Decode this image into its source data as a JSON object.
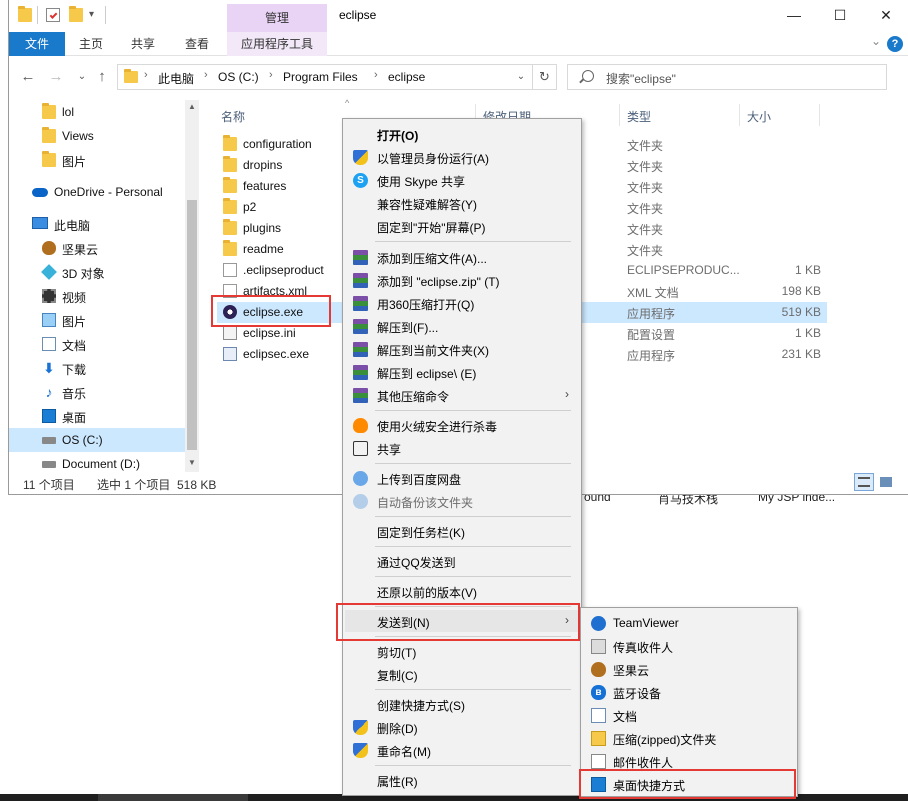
{
  "window": {
    "title": "eclipse",
    "manage_tab": "管理",
    "controls": {
      "minimize": "—",
      "maximize": "☐",
      "close": "✕"
    }
  },
  "ribbon": {
    "file": "文件",
    "tabs": [
      "主页",
      "共享",
      "查看"
    ],
    "app_tools": "应用程序工具",
    "help": "?"
  },
  "address": {
    "crumbs": [
      "此电脑",
      "OS (C:)",
      "Program Files",
      "eclipse"
    ],
    "search_placeholder": "搜索\"eclipse\""
  },
  "nav": {
    "items": [
      {
        "label": "lol",
        "icon": "folder-icon"
      },
      {
        "label": "Views",
        "icon": "folder-icon"
      },
      {
        "label": "图片",
        "icon": "folder-icon"
      },
      {
        "label": "OneDrive - Personal",
        "icon": "onedrive-icon"
      },
      {
        "label": "此电脑",
        "icon": "computer-icon"
      },
      {
        "label": "坚果云",
        "icon": "nutstore-icon"
      },
      {
        "label": "3D 对象",
        "icon": "3d-objects-icon"
      },
      {
        "label": "视频",
        "icon": "video-icon"
      },
      {
        "label": "图片",
        "icon": "pictures-icon"
      },
      {
        "label": "文档",
        "icon": "documents-icon"
      },
      {
        "label": "下载",
        "icon": "download-icon"
      },
      {
        "label": "音乐",
        "icon": "music-icon"
      },
      {
        "label": "桌面",
        "icon": "desktop-icon"
      },
      {
        "label": "OS (C:)",
        "icon": "drive-icon"
      },
      {
        "label": "Document (D:)",
        "icon": "drive-icon"
      }
    ]
  },
  "columns": {
    "name": "名称",
    "modified": "修改日期",
    "type": "类型",
    "size": "大小"
  },
  "files": [
    {
      "name": "configuration",
      "type": "文件夹",
      "size": ""
    },
    {
      "name": "dropins",
      "type": "文件夹",
      "size": ""
    },
    {
      "name": "features",
      "type": "文件夹",
      "size": ""
    },
    {
      "name": "p2",
      "type": "文件夹",
      "size": ""
    },
    {
      "name": "plugins",
      "type": "文件夹",
      "size": ""
    },
    {
      "name": "readme",
      "type": "文件夹",
      "size": ""
    },
    {
      "name": ".eclipseproduct",
      "type": "ECLIPSEPRODUC...",
      "size": "1 KB"
    },
    {
      "name": "artifacts.xml",
      "type": "XML 文档",
      "size": "198 KB"
    },
    {
      "name": "eclipse.exe",
      "type": "应用程序",
      "size": "519 KB"
    },
    {
      "name": "eclipse.ini",
      "type": "配置设置",
      "size": "1 KB"
    },
    {
      "name": "eclipsec.exe",
      "type": "应用程序",
      "size": "231 KB"
    }
  ],
  "status": {
    "count": "11 个项目",
    "selected": "选中 1 个项目  518 KB"
  },
  "desktop_labels": [
    "ound",
    "肖马技术栈",
    "My JSP inde..."
  ],
  "context_menu": {
    "open": "打开(O)",
    "run_as_admin": "以管理员身份运行(A)",
    "skype_share": "使用 Skype 共享",
    "troubleshoot": "兼容性疑难解答(Y)",
    "pin_start": "固定到\"开始\"屏幕(P)",
    "add_archive": "添加到压缩文件(A)...",
    "add_zip": "添加到 \"eclipse.zip\" (T)",
    "open_360": "用360压缩打开(Q)",
    "extract_to": "解压到(F)...",
    "extract_here": "解压到当前文件夹(X)",
    "extract_folder": "解压到 eclipse\\ (E)",
    "more_zip": "其他压缩命令",
    "huorong": "使用火绒安全进行杀毒",
    "share": "共享",
    "baidu_upload": "上传到百度网盘",
    "baidu_backup": "自动备份该文件夹",
    "pin_taskbar": "固定到任务栏(K)",
    "qq_send": "通过QQ发送到",
    "restore": "还原以前的版本(V)",
    "send_to": "发送到(N)",
    "cut": "剪切(T)",
    "copy": "复制(C)",
    "create_shortcut": "创建快捷方式(S)",
    "delete": "删除(D)",
    "rename": "重命名(M)",
    "properties": "属性(R)"
  },
  "send_to_menu": [
    {
      "label": "TeamViewer",
      "icon": "teamviewer-icon"
    },
    {
      "label": "传真收件人",
      "icon": "fax-icon"
    },
    {
      "label": "坚果云",
      "icon": "nutstore-icon"
    },
    {
      "label": "蓝牙设备",
      "icon": "bluetooth-icon"
    },
    {
      "label": "文档",
      "icon": "documents-icon"
    },
    {
      "label": "压缩(zipped)文件夹",
      "icon": "zip-folder-icon"
    },
    {
      "label": "邮件收件人",
      "icon": "mail-icon"
    },
    {
      "label": "桌面快捷方式",
      "icon": "desktop-shortcut-icon"
    }
  ],
  "colors": {
    "accent": "#1979ca",
    "selection": "#cce8ff",
    "highlight": "#e53935",
    "manage_tab": "#e9d4f5"
  }
}
